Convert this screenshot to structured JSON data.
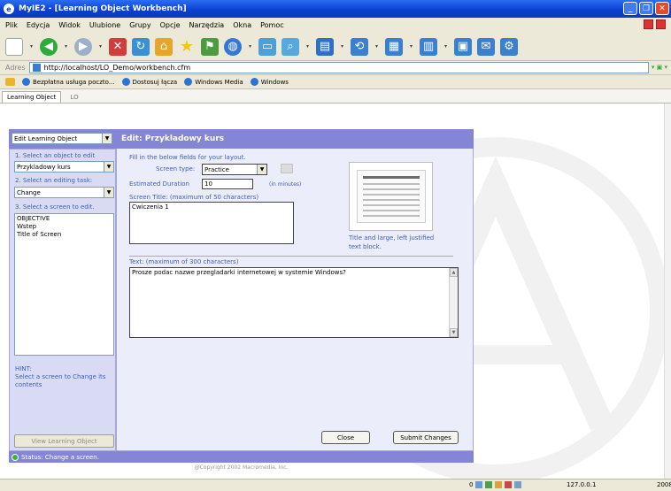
{
  "window": {
    "title": "MyIE2 - [Learning Object Workbench]"
  },
  "menu": [
    "Plik",
    "Edycja",
    "Widok",
    "Ulubione",
    "Grupy",
    "Opcje",
    "Narzędzia",
    "Okna",
    "Pomoc"
  ],
  "address": {
    "label": "Adres",
    "url": "http://localhost/LO_Demo/workbench.cfm"
  },
  "links": [
    "Bezpłatna usługa poczto...",
    "Dostosuj łącza",
    "Windows Media",
    "Windows"
  ],
  "tabs": [
    "Learning Object",
    "LO"
  ],
  "left_panel": {
    "mode_select": "Edit Learning Object",
    "step1_label": "1. Select an object to edit",
    "object_select": "Przykladowy kurs",
    "step2_label": "2. Select an editing task:",
    "task_select": "Change",
    "step3_label": "3. Select a screen to edit.",
    "screens": [
      "OBJECTIVE",
      "Wstep",
      "Title of Screen"
    ],
    "hint_title": "HINT:",
    "hint_text": "Select a screen to Change its contents",
    "view_button": "View Learning Object"
  },
  "edit": {
    "header": "Edit: Przykladowy kurs",
    "instructions": "Fill in the below fields for your layout.",
    "screen_type_label": "Screen type:",
    "screen_type_value": "Practice",
    "duration_label": "Estimated Duration",
    "duration_value": "10",
    "duration_unit": "(in minutes)",
    "screen_title_label": "Screen Title: (maximum of 50 characters)",
    "screen_title_value": "Cwiczenia 1",
    "layout_description": "Title and large, left justified text block.",
    "text_label": "Text: (maximum of 300 characters)",
    "text_value": "Prosze podac nazwe przegladarki internetowej w systemie Windows?",
    "close_button": "Close",
    "submit_button": "Submit Changes"
  },
  "status": {
    "text": "Status:  Change a screen.",
    "copyright": "@Copyright 2002 Macromedia, Inc."
  },
  "statusbar": {
    "count": "0",
    "ip": "127.0.0.1",
    "year": "2008"
  }
}
